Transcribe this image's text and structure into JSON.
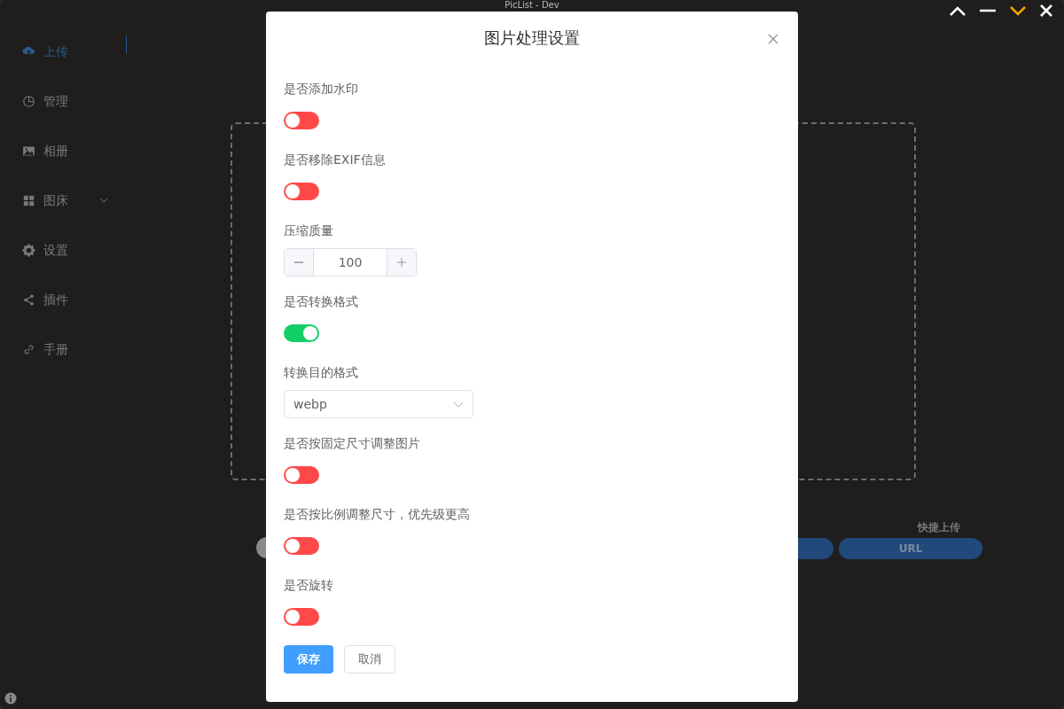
{
  "window": {
    "title": "PicList - Dev"
  },
  "sidebar": {
    "items": [
      {
        "label": "上传",
        "selected": true,
        "expandable": false
      },
      {
        "label": "管理",
        "selected": false,
        "expandable": false
      },
      {
        "label": "相册",
        "selected": false,
        "expandable": false
      },
      {
        "label": "图床",
        "selected": false,
        "expandable": true
      },
      {
        "label": "设置",
        "selected": false,
        "expandable": false
      },
      {
        "label": "插件",
        "selected": false,
        "expandable": false
      },
      {
        "label": "手册",
        "selected": false,
        "expandable": false
      }
    ]
  },
  "quick_upload": {
    "label": "快捷上传",
    "buttons": [
      "URL"
    ]
  },
  "dialog": {
    "title": "图片处理设置",
    "fields": [
      {
        "kind": "switch",
        "label": "是否添加水印",
        "on": false
      },
      {
        "kind": "switch",
        "label": "是否移除EXIF信息",
        "on": false
      },
      {
        "kind": "number",
        "label": "压缩质量",
        "value": "100"
      },
      {
        "kind": "switch",
        "label": "是否转换格式",
        "on": true
      },
      {
        "kind": "select",
        "label": "转换目的格式",
        "value": "webp"
      },
      {
        "kind": "switch",
        "label": "是否按固定尺寸调整图片",
        "on": false
      },
      {
        "kind": "switch",
        "label": "是否按比例调整尺寸，优先级更高",
        "on": false
      },
      {
        "kind": "switch",
        "label": "是否旋转",
        "on": false
      }
    ],
    "buttons": [
      {
        "label": "保存",
        "primary": true
      },
      {
        "label": "取消",
        "primary": false
      }
    ]
  }
}
